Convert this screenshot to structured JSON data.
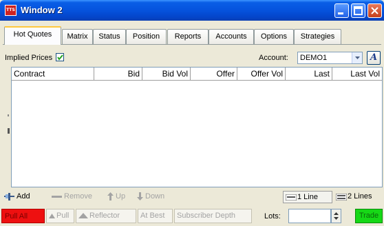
{
  "window": {
    "title": "Window 2",
    "app_icon_text": "TTS"
  },
  "tabs": [
    {
      "label": "Hot Quotes",
      "active": true
    },
    {
      "label": "Matrix"
    },
    {
      "label": "Status"
    },
    {
      "label": "Position"
    },
    {
      "label": "Reports"
    },
    {
      "label": "Accounts"
    },
    {
      "label": "Options"
    },
    {
      "label": "Strategies"
    }
  ],
  "toolbar": {
    "implied_prices_label": "Implied Prices",
    "implied_prices_checked": true,
    "account_label": "Account:",
    "account_value": "DEMO1",
    "font_button_label": "A"
  },
  "grid": {
    "columns": [
      "Contract",
      "Bid",
      "Bid Vol",
      "Offer",
      "Offer Vol",
      "Last",
      "Last Vol"
    ],
    "rows": []
  },
  "row_tools": {
    "add": "Add",
    "remove": "Remove",
    "up": "Up",
    "down": "Down",
    "one_line": "1 Line",
    "two_lines": "2 Lines"
  },
  "order_bar": {
    "pull_all": "Pull All",
    "pull": "Pull",
    "reflector": "Reflector",
    "at_best": "At Best",
    "subscriber_depth": "Subscriber Depth",
    "lots_label": "Lots:",
    "lots_value": "",
    "trade": "Trade"
  },
  "colors": {
    "title_bar": "#0553dd",
    "pull_all": "#ee1010",
    "trade": "#16d816",
    "active_tab_accent": "#ffc83c"
  }
}
